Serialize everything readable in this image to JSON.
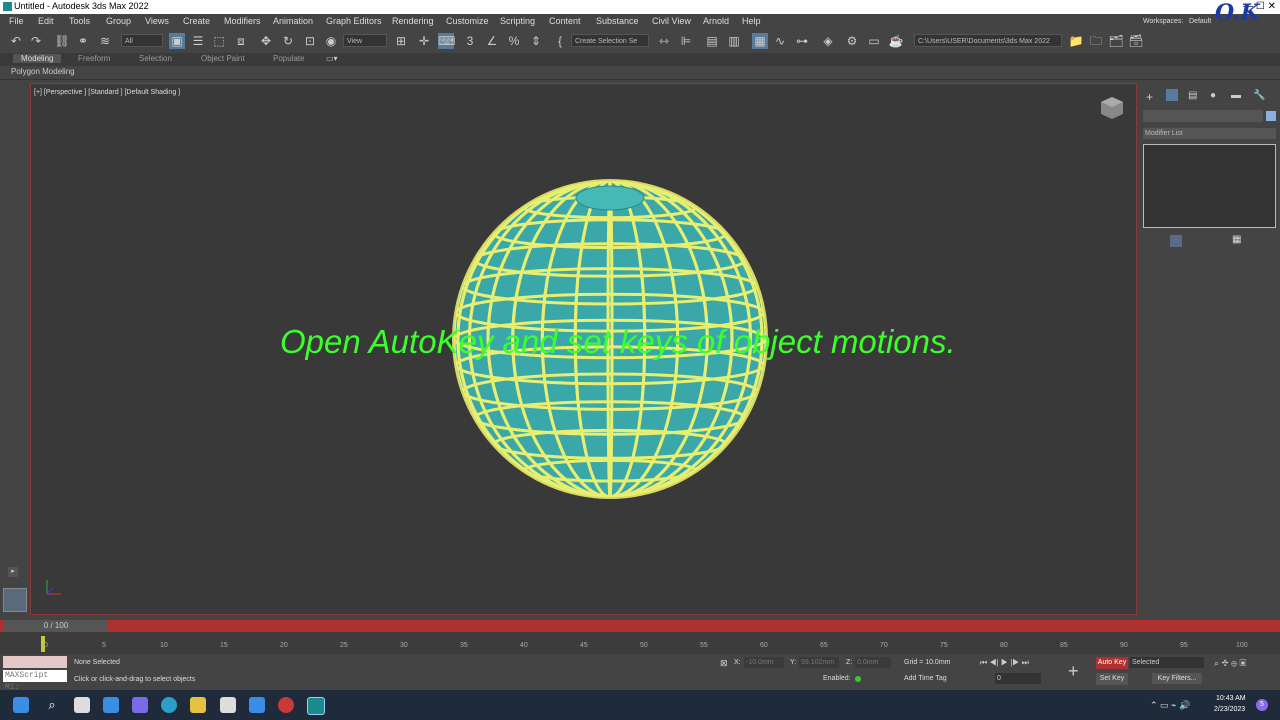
{
  "window": {
    "title": "Untitled - Autodesk 3ds Max 2022",
    "workspace_label": "Workspaces:",
    "workspace_value": "Default",
    "logo": "O.K"
  },
  "menu": [
    "File",
    "Edit",
    "Tools",
    "Group",
    "Views",
    "Create",
    "Modifiers",
    "Animation",
    "Graph Editors",
    "Rendering",
    "Customize",
    "Scripting",
    "Content",
    "Substance",
    "Civil View",
    "Arnold",
    "Help"
  ],
  "toolbar": {
    "filter": "All",
    "refcoord": "View",
    "selection_set": "Create Selection Se",
    "project_path": "C:\\Users\\USER\\Documents\\3ds Max 2022"
  },
  "ribbon": {
    "tabs": [
      "Modeling",
      "Freeform",
      "Selection",
      "Object Paint",
      "Populate"
    ],
    "active": "Modeling",
    "sub": "Polygon Modeling"
  },
  "viewport": {
    "label": "[+] [Perspective ] [Standard ] [Default Shading ]",
    "caption": "Open AutoKey and set keys of object motions."
  },
  "command_panel": {
    "modifier_list": "Modifier List"
  },
  "timeline": {
    "frame": "0 / 100",
    "ticks": [
      "0",
      "5",
      "10",
      "15",
      "20",
      "25",
      "30",
      "35",
      "40",
      "45",
      "50",
      "55",
      "60",
      "65",
      "70",
      "75",
      "80",
      "85",
      "90",
      "95",
      "100"
    ]
  },
  "status": {
    "maxscript": "MAXScript Mi:",
    "selection": "None Selected",
    "prompt": "Click or click-and-drag to select objects",
    "x_label": "X:",
    "x_value": "-10.0mm",
    "y_label": "Y:",
    "y_value": "59.102mm",
    "z_label": "Z:",
    "z_value": "0.0mm",
    "grid": "Grid = 10.0mm",
    "enabled": "Enabled:",
    "add_time_tag": "Add Time Tag",
    "auto_key": "Auto Key",
    "set_key": "Set Key",
    "selected": "Selected",
    "key_filters": "Key Filters...",
    "frame_field": "0"
  },
  "taskbar": {
    "time": "10:43 AM",
    "date": "2/23/2023",
    "notif": "5"
  },
  "colors": {
    "accent": "#3bff2a",
    "sphere": "#3aa8a8",
    "autokey": "#b03030"
  }
}
